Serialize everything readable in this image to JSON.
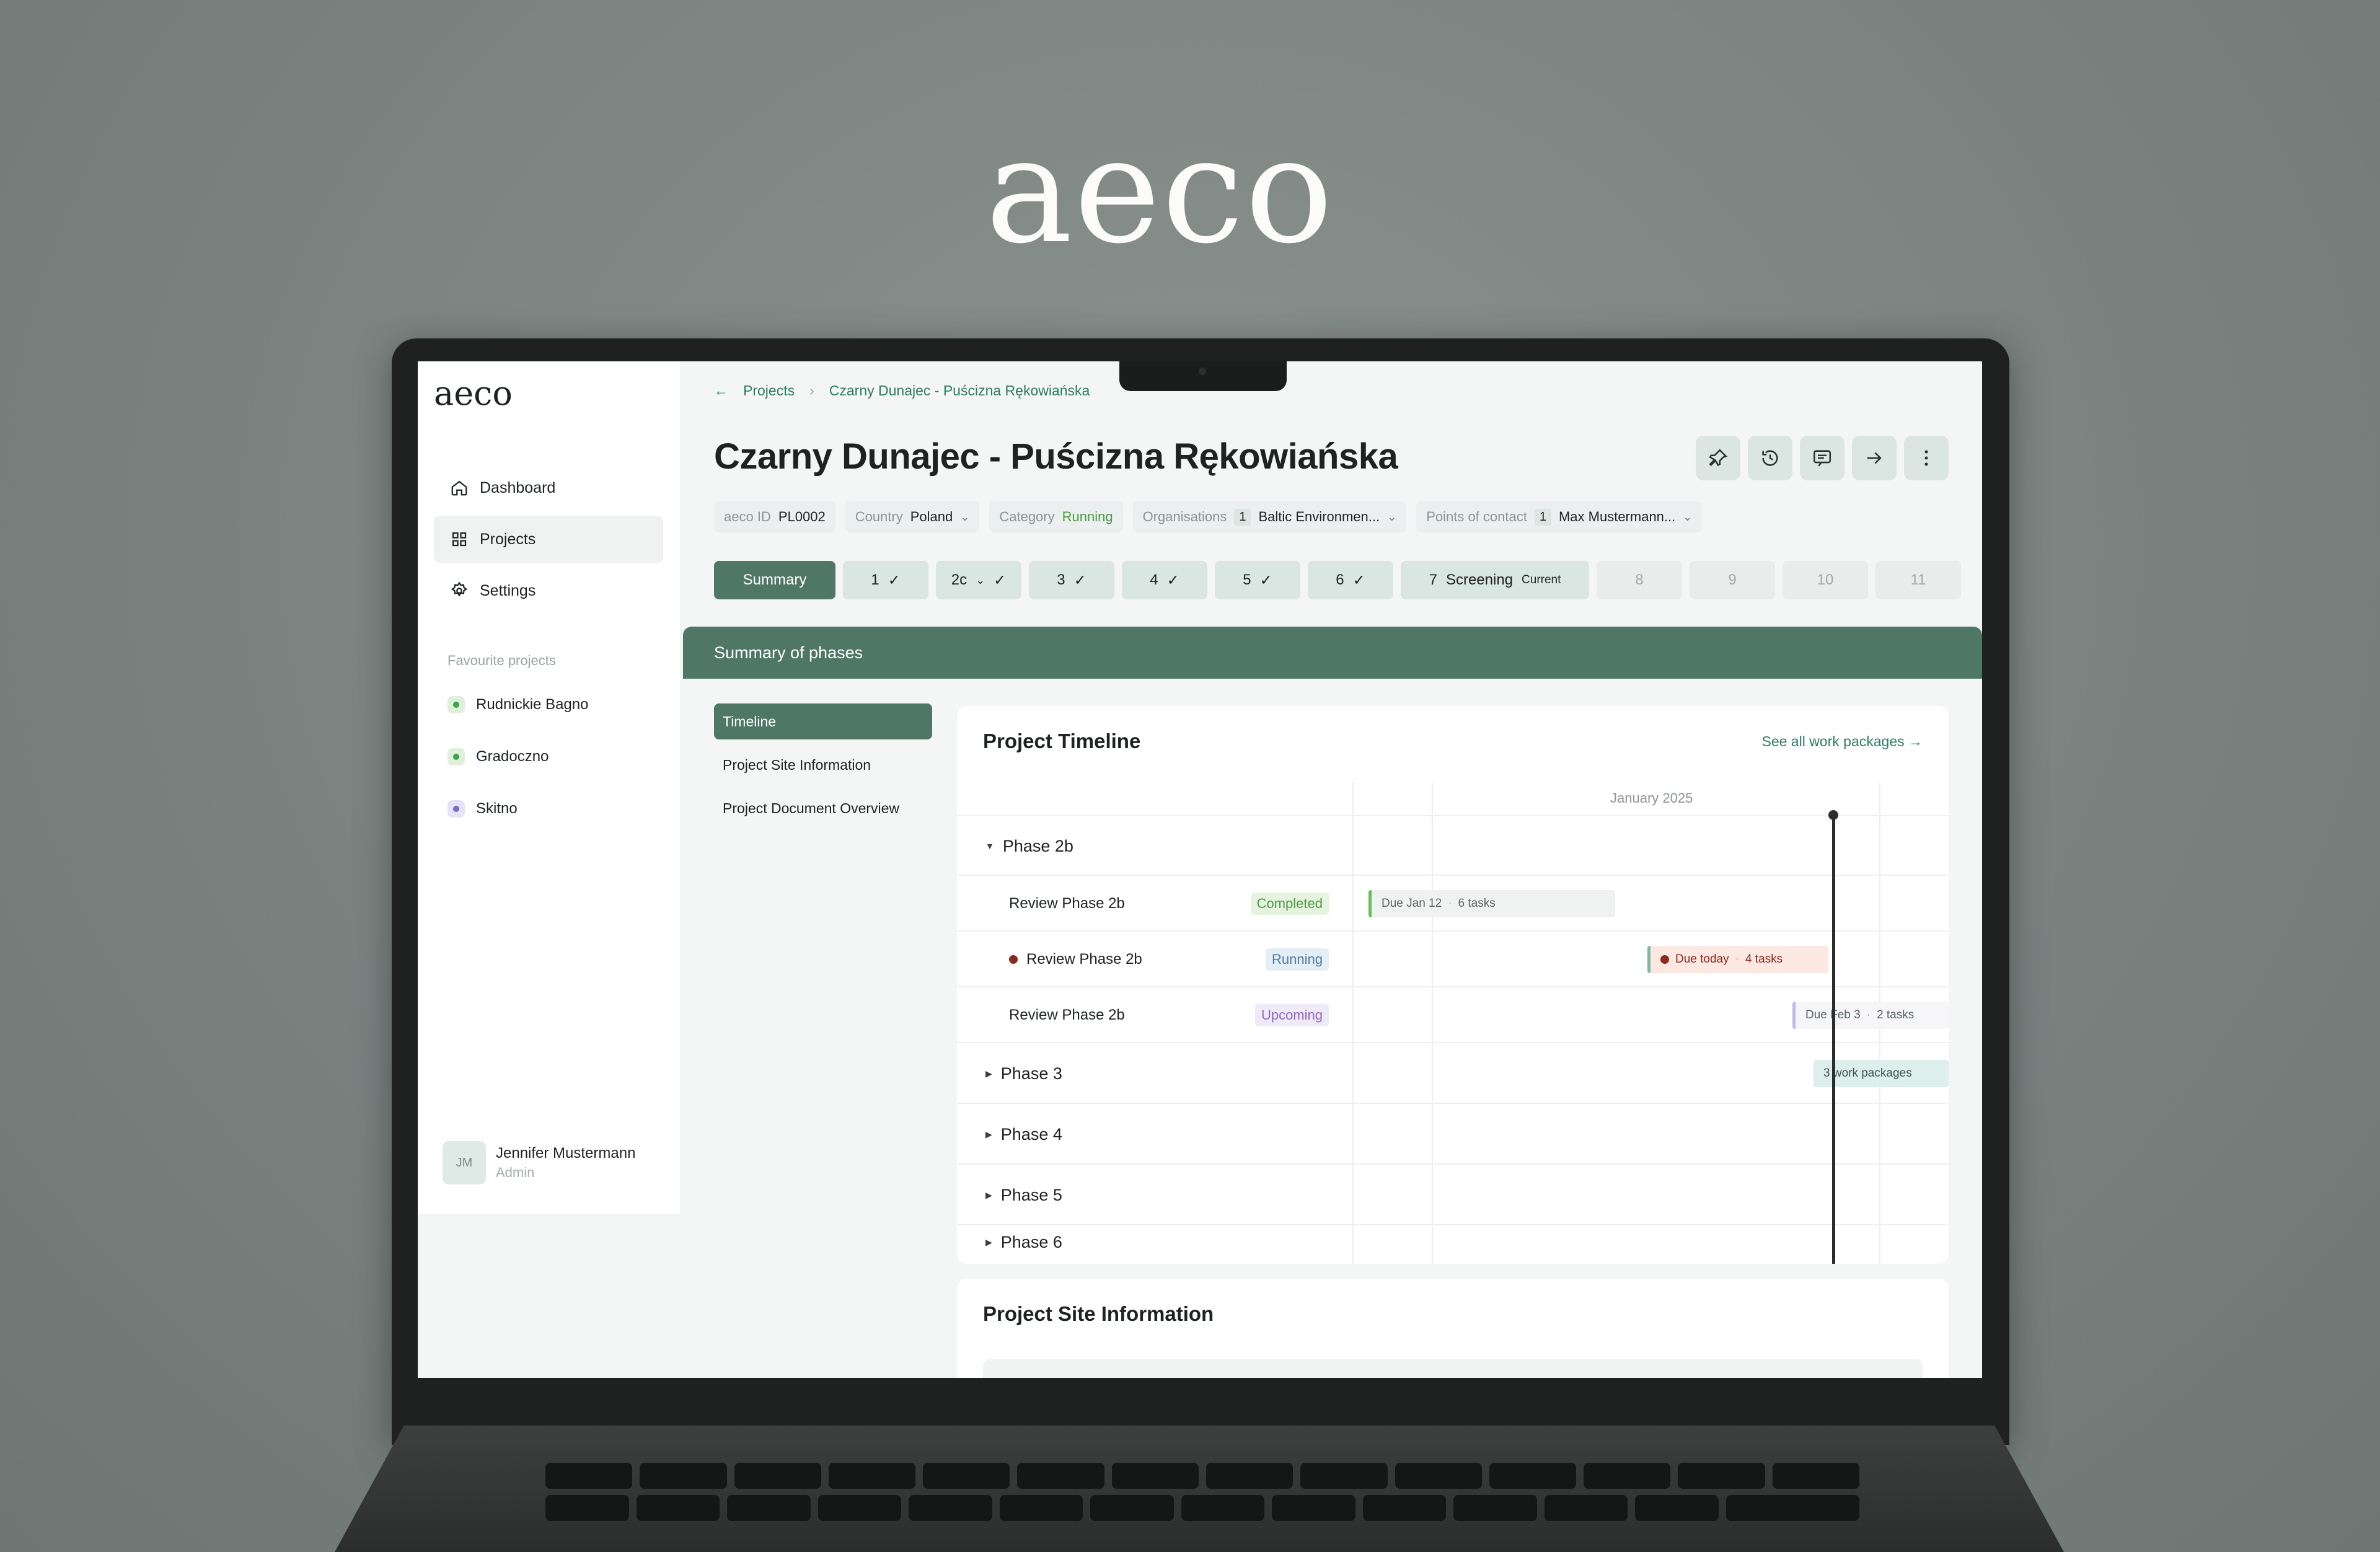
{
  "hero": {
    "logo": "aeco"
  },
  "sidebar": {
    "logo": "aeco",
    "nav": [
      {
        "label": "Dashboard",
        "icon": "home-icon"
      },
      {
        "label": "Projects",
        "icon": "grid-icon"
      },
      {
        "label": "Settings",
        "icon": "gear-icon"
      }
    ],
    "favourites_title": "Favourite projects",
    "favourites": [
      {
        "label": "Rudnickie Bagno",
        "color": "#3fa34d"
      },
      {
        "label": "Gradoczno",
        "color": "#3fa34d"
      },
      {
        "label": "Skitno",
        "color": "#7b68c9"
      }
    ],
    "user": {
      "initials": "JM",
      "name": "Jennifer Mustermann",
      "role": "Admin"
    }
  },
  "breadcrumb": {
    "back": "←",
    "projects": "Projects",
    "separator": "›",
    "current": "Czarny Dunajec - Puścizna Rękowiańska"
  },
  "page_title": "Czarny Dunajec - Puścizna Rękowiańska",
  "actions": [
    "pin-icon",
    "history-icon",
    "comment-icon",
    "arrow-right-icon",
    "more-icon"
  ],
  "meta": {
    "aeco_id": {
      "label": "aeco ID",
      "value": "PL0002"
    },
    "country": {
      "label": "Country",
      "value": "Poland"
    },
    "category": {
      "label": "Category",
      "value": "Running"
    },
    "organisations": {
      "label": "Organisations",
      "count": "1",
      "value": "Baltic Environmen..."
    },
    "contacts": {
      "label": "Points of contact",
      "count": "1",
      "value": "Max Mustermann..."
    }
  },
  "phase_tabs": {
    "summary": "Summary",
    "done": [
      "1",
      "2c",
      "3",
      "4",
      "5",
      "6"
    ],
    "current": {
      "number": "7",
      "label": "Screening",
      "tag": "Current"
    },
    "future": [
      "8",
      "9",
      "10",
      "11"
    ]
  },
  "summary_bar": "Summary of phases",
  "subnav": [
    "Timeline",
    "Project Site Information",
    "Project Document Overview"
  ],
  "timeline": {
    "title": "Project Timeline",
    "see_all": "See all work packages →",
    "month": "January 2025",
    "phase_2b": "Phase 2b",
    "rows": [
      {
        "label": "Review Phase 2b",
        "status": "Completed",
        "bar_due": "Due Jan 12",
        "bar_tasks": "6 tasks"
      },
      {
        "label": "Review Phase 2b",
        "status": "Running",
        "bar_due": "Due today",
        "bar_tasks": "4 tasks"
      },
      {
        "label": "Review Phase 2b",
        "status": "Upcoming",
        "bar_due": "Due Feb 3",
        "bar_tasks": "2 tasks"
      }
    ],
    "phase_3": "Phase 3",
    "phase_3_bar": "3 work packages",
    "phase_4": "Phase 4",
    "phase_5": "Phase 5",
    "phase_6": "Phase 6"
  },
  "site_info": {
    "title": "Project Site Information"
  },
  "colors": {
    "accent": "#4e7766",
    "link": "#2f7c64",
    "background": "#7e8684"
  }
}
